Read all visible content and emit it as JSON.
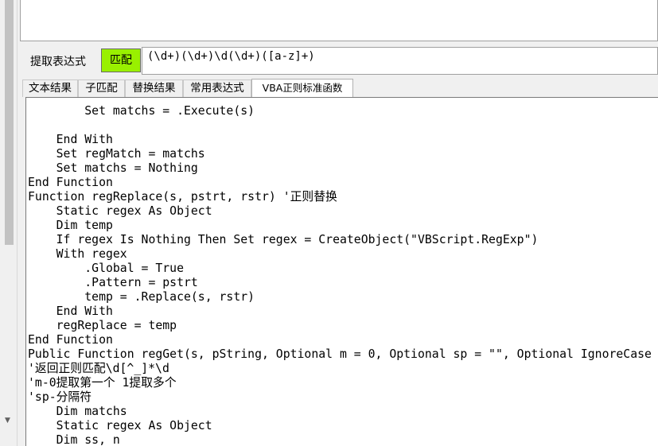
{
  "extract_label": "提取表达式",
  "match_button": "匹配",
  "regex_value": "(\\d+)(\\d+)\\d(\\d+)([a-z]+)",
  "tabs": [
    "文本结果",
    "子匹配",
    "替换结果",
    "常用表达式",
    "VBA正则标准函数"
  ],
  "active_tab": "VBA正则标准函数",
  "code_lines": [
    "        Set matchs = .Execute(s)",
    "",
    "    End With",
    "    Set regMatch = matchs",
    "    Set matchs = Nothing",
    "End Function",
    "Function regReplace(s, pstrt, rstr) '正则替换",
    "    Static regex As Object",
    "    Dim temp",
    "    If regex Is Nothing Then Set regex = CreateObject(\"VBScript.RegExp\")",
    "    With regex",
    "        .Global = True",
    "        .Pattern = pstrt",
    "        temp = .Replace(s, rstr)",
    "    End With",
    "    regReplace = temp",
    "End Function",
    "Public Function regGet(s, pString, Optional m = 0, Optional sp = \"\", Optional IgnoreCase",
    "'返回正则匹配\\d[^_]*\\d",
    "'m-0提取第一个 1提取多个",
    "'sp-分隔符",
    "    Dim matchs",
    "    Static regex As Object",
    "    Dim ss, n"
  ]
}
